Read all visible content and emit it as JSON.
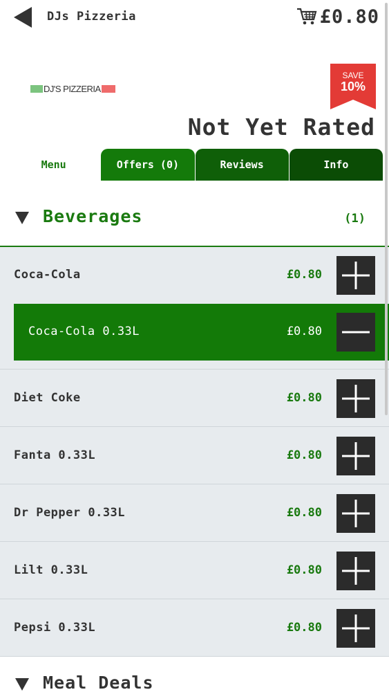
{
  "header": {
    "title": "DJs Pizzeria",
    "cart_total": "£0.80"
  },
  "logo": {
    "text": "DJ'S PIZZERIA"
  },
  "promo": {
    "save_label": "SAVE",
    "save_percent": "10%"
  },
  "rating": "Not Yet Rated",
  "tabs": [
    {
      "label": "Menu",
      "active": true
    },
    {
      "label": "Offers (0)"
    },
    {
      "label": "Reviews"
    },
    {
      "label": "Info"
    }
  ],
  "categories": [
    {
      "name": "Beverages",
      "count": "(1)",
      "expanded": true
    },
    {
      "name": "Meal Deals",
      "expanded": false
    }
  ],
  "items": [
    {
      "name": "Coca-Cola",
      "price": "£0.80"
    },
    {
      "name": "Diet Coke",
      "price": "£0.80"
    },
    {
      "name": "Fanta 0.33L",
      "price": "£0.80"
    },
    {
      "name": "Dr Pepper 0.33L",
      "price": "£0.80"
    },
    {
      "name": "Lilt 0.33L",
      "price": "£0.80"
    },
    {
      "name": "Pepsi 0.33L",
      "price": "£0.80"
    }
  ],
  "selected_variant": {
    "name": "Coca-Cola 0.33L",
    "price": "£0.80"
  },
  "colors": {
    "brand_green": "#1a7a10",
    "selected_green": "#137a08",
    "save_red": "#e33b36",
    "button_dark": "#2b2b2b",
    "list_bg": "#e7ebee"
  },
  "icons": {
    "back": "back-arrow-icon",
    "cart": "shopping-cart-icon",
    "expand": "triangle-down-icon",
    "add": "plus-icon",
    "remove": "minus-icon"
  }
}
